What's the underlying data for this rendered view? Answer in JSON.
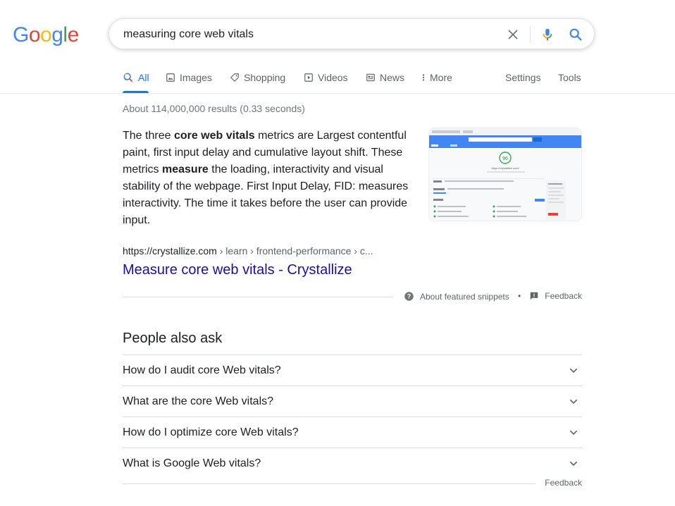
{
  "logo": {
    "letters": [
      "G",
      "o",
      "o",
      "g",
      "l",
      "e"
    ],
    "colors": [
      "#4285f4",
      "#ea4335",
      "#fbbc05",
      "#4285f4",
      "#34a853",
      "#ea4335"
    ]
  },
  "search": {
    "query": "measuring core web vitals"
  },
  "tabs": [
    {
      "label": "All",
      "icon": "search-icon"
    },
    {
      "label": "Images",
      "icon": "image-icon"
    },
    {
      "label": "Shopping",
      "icon": "tag-icon"
    },
    {
      "label": "Videos",
      "icon": "play-icon"
    },
    {
      "label": "News",
      "icon": "news-icon"
    },
    {
      "label": "More",
      "icon": "more-vert-icon"
    }
  ],
  "tools": {
    "settings": "Settings",
    "tools": "Tools"
  },
  "result_stats": "About 114,000,000 results (0.33 seconds)",
  "snippet": {
    "parts": [
      {
        "t": "The three ",
        "b": false
      },
      {
        "t": "core web vitals",
        "b": true
      },
      {
        "t": " metrics are Largest contentful paint, first input delay and cumulative layout shift. These metrics ",
        "b": false
      },
      {
        "t": "measure",
        "b": true
      },
      {
        "t": " the loading, interactivity and visual stability of the webpage. First Input Delay, FID: measures interactivity. The time it takes before the user can provide input.",
        "b": false
      }
    ]
  },
  "thumbnail": {
    "score": "96",
    "url": "https://crystallize.com/"
  },
  "result": {
    "url": "https://crystallize.com",
    "breadcrumbs": " › learn › frontend-performance › c...",
    "title": "Measure core web vitals - Crystallize"
  },
  "snippet_footer": {
    "about": "About featured snippets",
    "dot": "•",
    "feedback": "Feedback"
  },
  "paa": {
    "title": "People also ask",
    "questions": [
      "How do I audit core Web vitals?",
      "What are the core Web vitals?",
      "How do I optimize core Web vitals?",
      "What is Google Web vitals?"
    ],
    "feedback": "Feedback"
  },
  "colors": {
    "link": "#1a0dab",
    "accent": "#1a73e8",
    "muted": "#5f6368"
  }
}
